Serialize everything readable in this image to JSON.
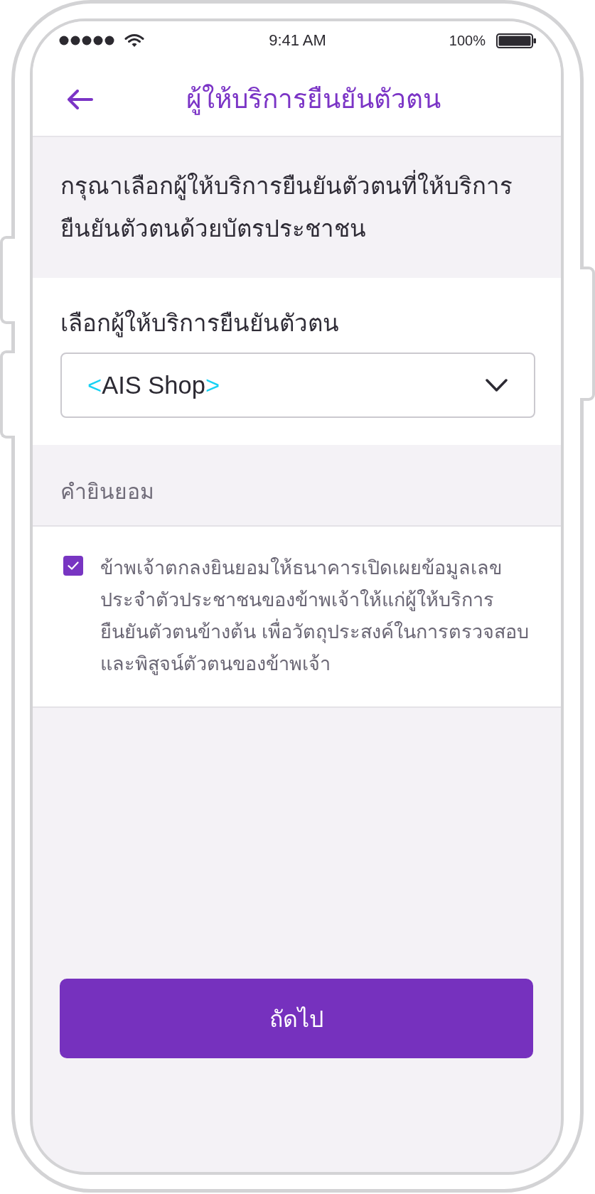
{
  "status_bar": {
    "time": "9:41 AM",
    "battery_percent": "100%"
  },
  "nav_bar": {
    "title": "ผู้ให้บริการยืนยันตัวตน"
  },
  "instruction": {
    "text": "กรุณาเลือกผู้ให้บริการยืนยันตัวตนที่ให้บริการยืนยันตัวตนด้วยบัตรประชาชน"
  },
  "provider_select": {
    "label": "เลือกผู้ให้บริการยืนยันตัวตน",
    "value_open": "<",
    "value": "AIS Shop",
    "value_close": ">"
  },
  "consent": {
    "heading": "คำยินยอม",
    "checkbox": {
      "checked": true,
      "text": "ข้าพเจ้าตกลงยินยอมให้ธนาคารเปิดเผยข้อมูลเลขประจำตัวประชาชนของข้าพเจ้าให้แก่ผู้ให้บริการยืนยันตัวตนข้างต้น เพื่อวัตถุประสงค์ในการตรวจสอบและพิสูจน์ตัวตนของข้าพเจ้า"
    }
  },
  "next_button": {
    "label": "ถัดไป"
  }
}
